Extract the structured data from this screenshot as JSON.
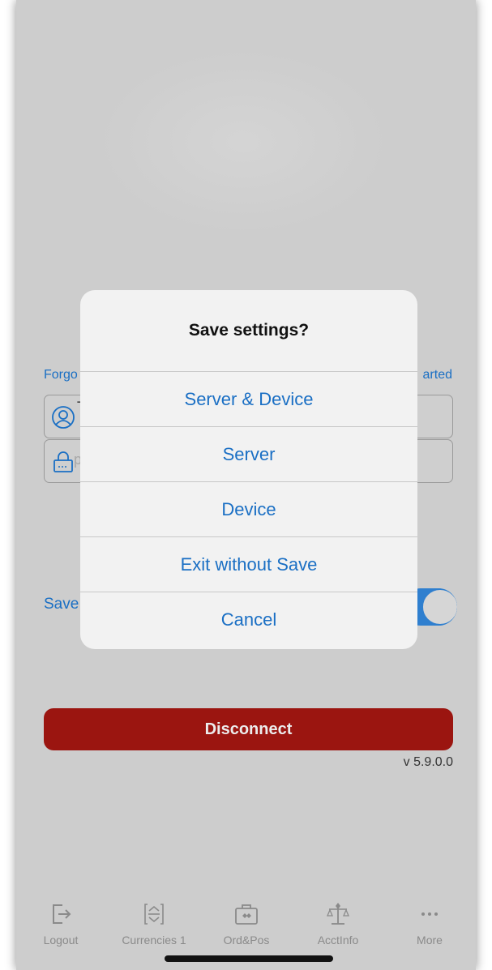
{
  "background": {
    "forgot_link": "Forgo",
    "get_started_link": "arted",
    "username_field": {
      "value": "T",
      "icon": "user-icon"
    },
    "password_field": {
      "placeholder": "p",
      "icon": "lock-icon"
    },
    "save_label": "Save",
    "toggle_on": true,
    "disconnect_label": "Disconnect",
    "version": "v 5.9.0.0"
  },
  "dialog": {
    "title": "Save settings?",
    "options": [
      {
        "label": "Server & Device"
      },
      {
        "label": "Server"
      },
      {
        "label": "Device"
      },
      {
        "label": "Exit without Save"
      },
      {
        "label": "Cancel"
      }
    ]
  },
  "tabbar": {
    "tabs": [
      {
        "label": "Logout",
        "icon": "logout-icon"
      },
      {
        "label": "Currencies 1",
        "icon": "currencies-icon"
      },
      {
        "label": "Ord&Pos",
        "icon": "briefcase-icon"
      },
      {
        "label": "AcctInfo",
        "icon": "scales-icon"
      },
      {
        "label": "More",
        "icon": "more-icon"
      }
    ]
  },
  "colors": {
    "accent": "#1a6fc4",
    "disconnect": "#9b1510",
    "overlay_bg": "#cdcdcd",
    "dialog_bg": "#f2f2f2"
  }
}
